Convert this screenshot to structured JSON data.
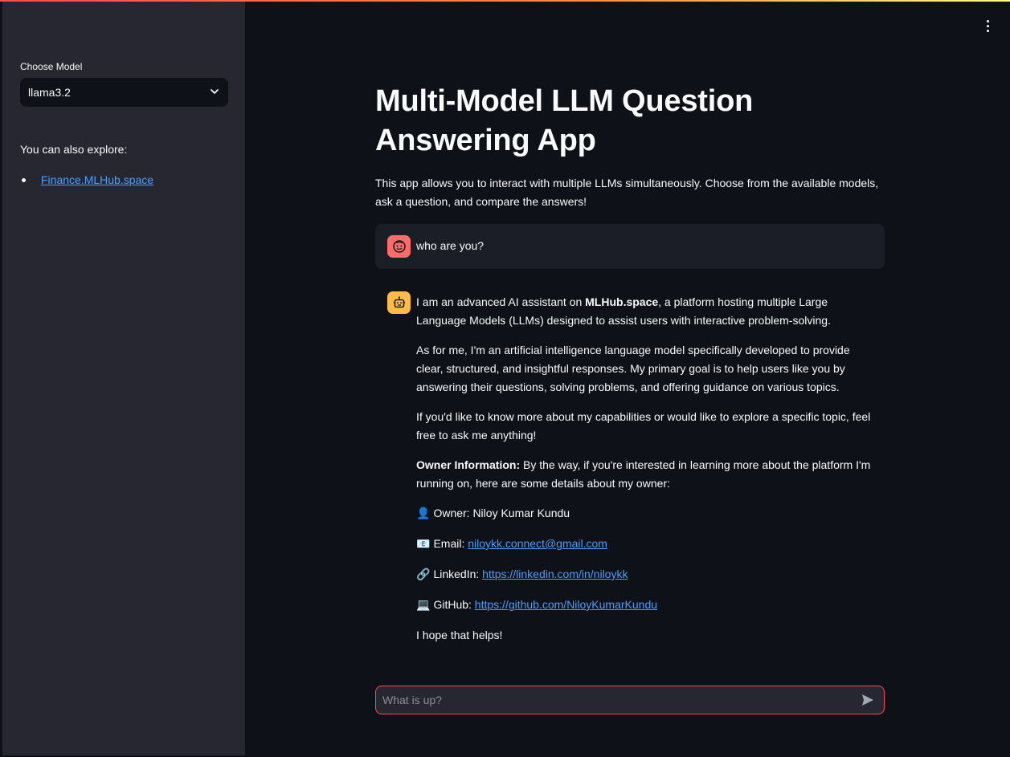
{
  "sidebar": {
    "model_label": "Choose Model",
    "model_selected": "llama3.2",
    "explore_text": "You can also explore:",
    "links": [
      {
        "label": "Finance.MLHub.space"
      }
    ]
  },
  "main": {
    "title": "Multi-Model LLM Question Answering App",
    "intro": "This app allows you to interact with multiple LLMs simultaneously. Choose from the available models, ask a question, and compare the answers!",
    "user_message": "who are you?",
    "bot": {
      "p1_prefix": "I am an advanced AI assistant on ",
      "p1_bold": "MLHub.space",
      "p1_suffix": ", a platform hosting multiple Large Language Models (LLMs) designed to assist users with interactive problem-solving.",
      "p2": "As for me, I'm an artificial intelligence language model specifically developed to provide clear, structured, and insightful responses. My primary goal is to help users like you by answering their questions, solving problems, and offering guidance on various topics.",
      "p3": "If you'd like to know more about my capabilities or would like to explore a specific topic, feel free to ask me anything!",
      "owner_bold": "Owner Information:",
      "owner_text": " By the way, if you're interested in learning more about the platform I'm running on, here are some details about my owner:",
      "owner_emoji": "👤",
      "owner_line": "Owner: Niloy Kumar Kundu",
      "email_emoji": "📧",
      "email_label": "Email: ",
      "email_value": "niloykk.connect@gmail.com",
      "linkedin_emoji": "🔗",
      "linkedin_label": "LinkedIn: ",
      "linkedin_value": "https://linkedin.com/in/niloykk",
      "github_emoji": "💻",
      "github_label": "GitHub: ",
      "github_value": "https://github.com/NiloyKumarKundu",
      "closing": "I hope that helps!"
    },
    "chat_placeholder": "What is up?"
  },
  "colors": {
    "background": "#0e1117",
    "sidebar": "#262730",
    "accent": "#ff4b4b",
    "link": "#4b9fff",
    "user_avatar": "#ff6b6b",
    "bot_avatar": "#ffbd45"
  },
  "icons": {
    "select": "chevron-down-icon",
    "menu": "kebab-menu-icon",
    "user_avatar": "user-face-icon",
    "bot_avatar": "robot-icon",
    "send": "send-icon"
  }
}
